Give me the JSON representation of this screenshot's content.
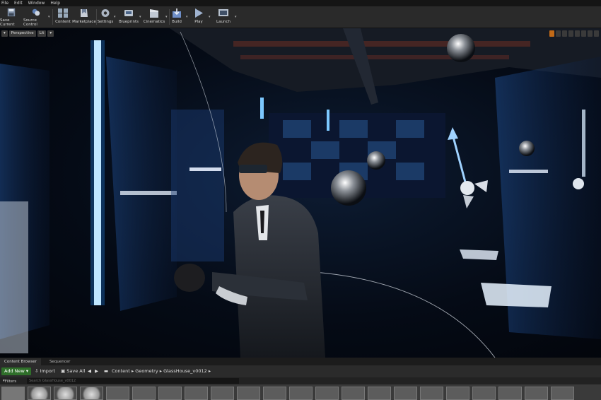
{
  "menu": [
    "File",
    "Edit",
    "Window",
    "Help"
  ],
  "toolbar": [
    {
      "label": "Save Current",
      "icon": "save-icon"
    },
    {
      "label": "Source Control",
      "icon": "source-control-icon"
    },
    {
      "label": "Content",
      "icon": "content-icon"
    },
    {
      "label": "Marketplace",
      "icon": "marketplace-icon"
    },
    {
      "label": "Settings",
      "icon": "settings-icon"
    },
    {
      "label": "Blueprints",
      "icon": "blueprints-icon"
    },
    {
      "label": "Cinematics",
      "icon": "cinematics-icon"
    },
    {
      "label": "Build",
      "icon": "build-icon"
    },
    {
      "label": "Play",
      "icon": "play-icon"
    },
    {
      "label": "Launch",
      "icon": "launch-icon"
    }
  ],
  "viewport": {
    "perspective_label": "Perspective",
    "lit_label": "Lit",
    "scene": "Man wearing VR headset and gesturing with a hand controller inside a dark blue-lit glass gallery with display cases, floating chrome spheres and a translate gizmo"
  },
  "panel_tabs": [
    "Content Browser",
    "Sequencer"
  ],
  "content_browser": {
    "add_new": "Add New",
    "import": "Import",
    "save_all": "Save All",
    "breadcrumb": [
      "Content",
      "Geometry",
      "GlassHouse_v0012"
    ],
    "filters": "Filters",
    "search_placeholder": "Search GlassHouse_v0012"
  },
  "colors": {
    "accent_green": "#2f6f2a",
    "glow_blue": "#38a8ff",
    "toolbar_bg": "#2a2a2a"
  }
}
